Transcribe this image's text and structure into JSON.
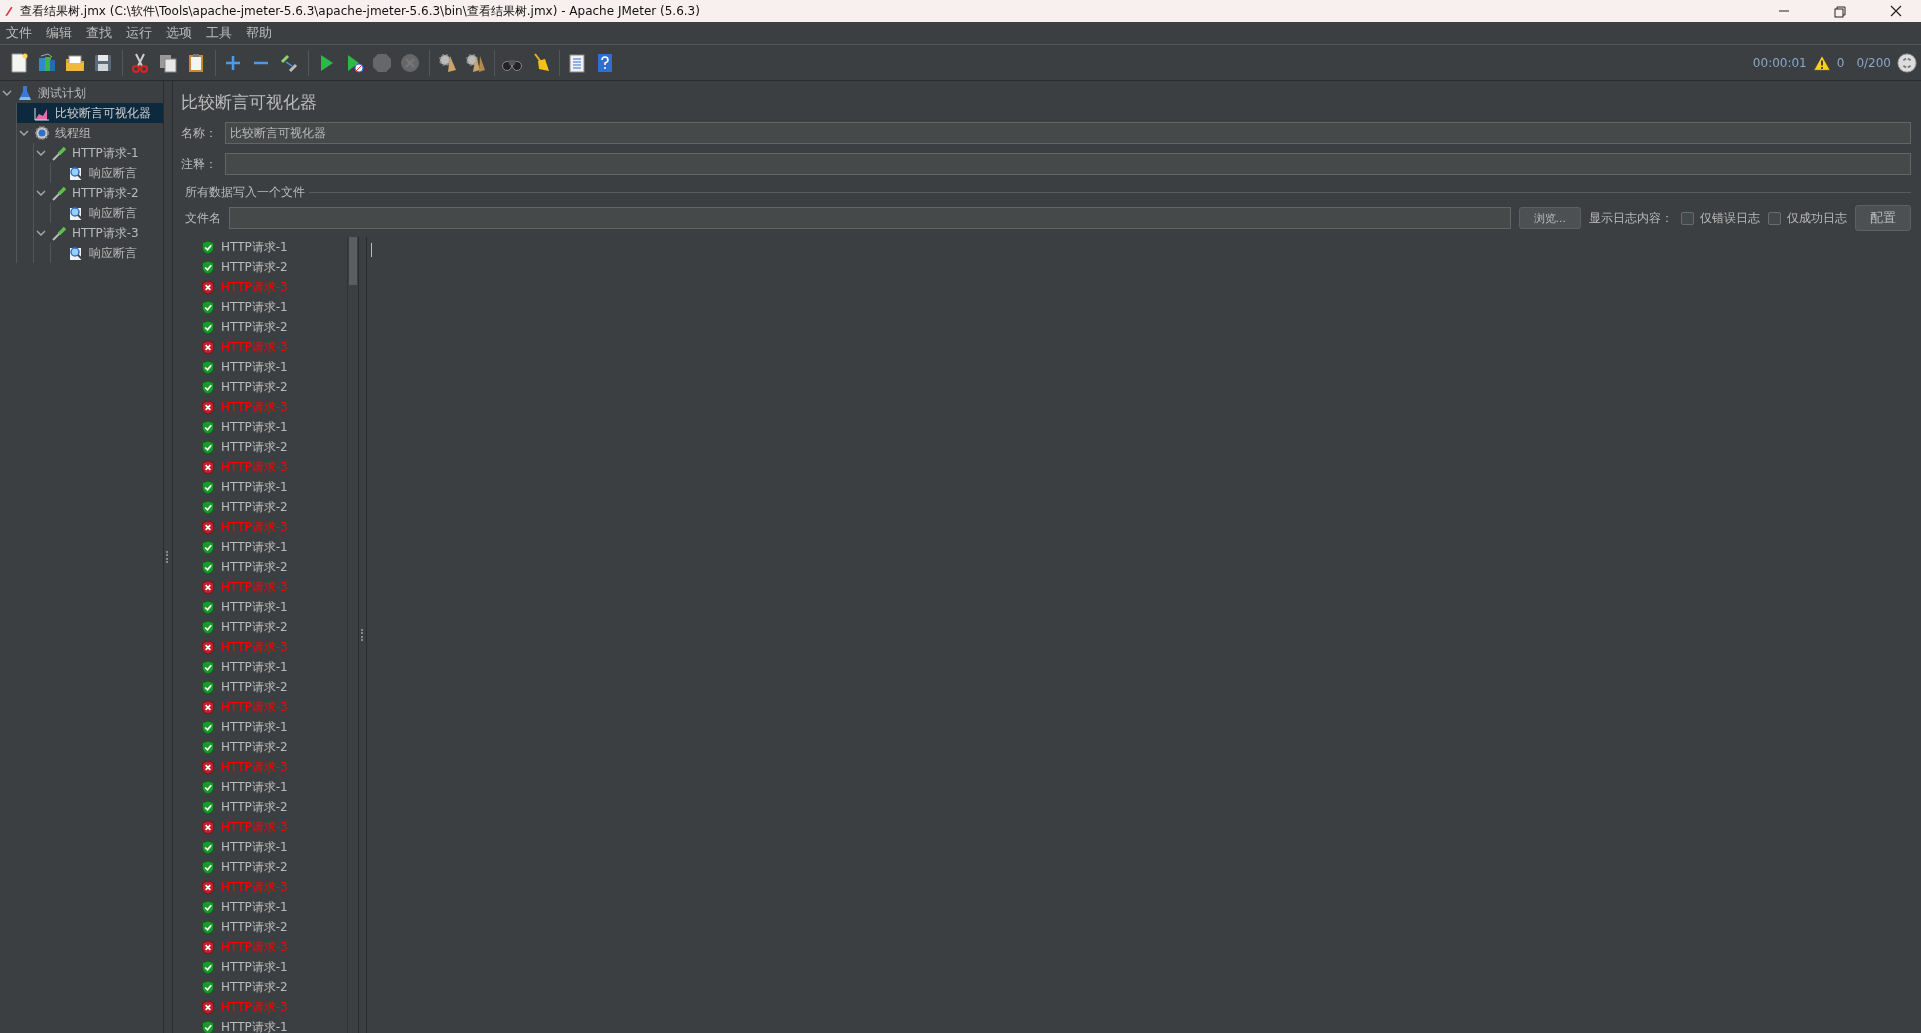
{
  "window": {
    "title": "查看结果树.jmx (C:\\软件\\Tools\\apache-jmeter-5.6.3\\apache-jmeter-5.6.3\\bin\\查看结果树.jmx) - Apache JMeter (5.6.3)"
  },
  "menu": [
    "文件",
    "编辑",
    "查找",
    "运行",
    "选项",
    "工具",
    "帮助"
  ],
  "toolbar": [
    {
      "kind": "new",
      "disabled": false
    },
    {
      "kind": "templates",
      "disabled": false
    },
    {
      "kind": "open",
      "disabled": false
    },
    {
      "kind": "save",
      "disabled": false
    },
    {
      "kind": "sep"
    },
    {
      "kind": "cut",
      "disabled": false
    },
    {
      "kind": "copy",
      "disabled": false
    },
    {
      "kind": "paste",
      "disabled": false
    },
    {
      "kind": "sep"
    },
    {
      "kind": "expand",
      "disabled": false
    },
    {
      "kind": "collapse",
      "disabled": false
    },
    {
      "kind": "toggle",
      "disabled": false
    },
    {
      "kind": "sep"
    },
    {
      "kind": "start",
      "disabled": false
    },
    {
      "kind": "start_nopause",
      "disabled": false
    },
    {
      "kind": "stop",
      "disabled": true
    },
    {
      "kind": "shutdown",
      "disabled": true
    },
    {
      "kind": "sep"
    },
    {
      "kind": "clear",
      "disabled": false
    },
    {
      "kind": "clear_all",
      "disabled": false
    },
    {
      "kind": "sep"
    },
    {
      "kind": "search",
      "disabled": false
    },
    {
      "kind": "reset",
      "disabled": false
    },
    {
      "kind": "sep"
    },
    {
      "kind": "functions",
      "disabled": false
    },
    {
      "kind": "help",
      "disabled": false
    }
  ],
  "status": {
    "elapsed": "00:00:01",
    "warnings": "0",
    "threads": "0/200"
  },
  "tree": [
    {
      "label": "测试计划",
      "kind": "plan",
      "selected": false,
      "expanded": true,
      "children": [
        {
          "label": "比较断言可视化器",
          "kind": "visualizer",
          "selected": true
        },
        {
          "label": "线程组",
          "kind": "threads",
          "selected": false,
          "expanded": true,
          "children": [
            {
              "label": "HTTP请求-1",
              "kind": "sampler",
              "selected": false,
              "expanded": true,
              "children": [
                {
                  "label": "响应断言",
                  "kind": "assertion",
                  "selected": false
                }
              ]
            },
            {
              "label": "HTTP请求-2",
              "kind": "sampler",
              "selected": false,
              "expanded": true,
              "children": [
                {
                  "label": "响应断言",
                  "kind": "assertion",
                  "selected": false
                }
              ]
            },
            {
              "label": "HTTP请求-3",
              "kind": "sampler",
              "selected": false,
              "expanded": true,
              "children": [
                {
                  "label": "响应断言",
                  "kind": "assertion",
                  "selected": false
                }
              ]
            }
          ]
        }
      ]
    }
  ],
  "panel": {
    "title": "比较断言可视化器",
    "name_label": "名称：",
    "name_value": "比较断言可视化器",
    "comment_label": "注释：",
    "file_group": "所有数据写入一个文件",
    "filename_label": "文件名",
    "browse_button": "浏览...",
    "log_label": "显示日志内容：",
    "checkboxes": [
      {
        "label": "仅错误日志",
        "checked": false
      },
      {
        "label": "仅成功日志",
        "checked": false
      }
    ],
    "config_button": "配置"
  },
  "results": [
    {
      "label": "HTTP请求-1",
      "passed": true
    },
    {
      "label": "HTTP请求-2",
      "passed": true
    },
    {
      "label": "HTTP请求-3",
      "passed": false
    },
    {
      "label": "HTTP请求-1",
      "passed": true
    },
    {
      "label": "HTTP请求-2",
      "passed": true
    },
    {
      "label": "HTTP请求-3",
      "passed": false
    },
    {
      "label": "HTTP请求-1",
      "passed": true
    },
    {
      "label": "HTTP请求-2",
      "passed": true
    },
    {
      "label": "HTTP请求-3",
      "passed": false
    },
    {
      "label": "HTTP请求-1",
      "passed": true
    },
    {
      "label": "HTTP请求-2",
      "passed": true
    },
    {
      "label": "HTTP请求-3",
      "passed": false
    },
    {
      "label": "HTTP请求-1",
      "passed": true
    },
    {
      "label": "HTTP请求-2",
      "passed": true
    },
    {
      "label": "HTTP请求-3",
      "passed": false
    },
    {
      "label": "HTTP请求-1",
      "passed": true
    },
    {
      "label": "HTTP请求-2",
      "passed": true
    },
    {
      "label": "HTTP请求-3",
      "passed": false
    },
    {
      "label": "HTTP请求-1",
      "passed": true
    },
    {
      "label": "HTTP请求-2",
      "passed": true
    },
    {
      "label": "HTTP请求-3",
      "passed": false
    },
    {
      "label": "HTTP请求-1",
      "passed": true
    },
    {
      "label": "HTTP请求-2",
      "passed": true
    },
    {
      "label": "HTTP请求-3",
      "passed": false
    },
    {
      "label": "HTTP请求-1",
      "passed": true
    },
    {
      "label": "HTTP请求-2",
      "passed": true
    },
    {
      "label": "HTTP请求-3",
      "passed": false
    },
    {
      "label": "HTTP请求-1",
      "passed": true
    },
    {
      "label": "HTTP请求-2",
      "passed": true
    },
    {
      "label": "HTTP请求-3",
      "passed": false
    },
    {
      "label": "HTTP请求-1",
      "passed": true
    },
    {
      "label": "HTTP请求-2",
      "passed": true
    },
    {
      "label": "HTTP请求-3",
      "passed": false
    },
    {
      "label": "HTTP请求-1",
      "passed": true
    },
    {
      "label": "HTTP请求-2",
      "passed": true
    },
    {
      "label": "HTTP请求-3",
      "passed": false
    },
    {
      "label": "HTTP请求-1",
      "passed": true
    },
    {
      "label": "HTTP请求-2",
      "passed": true
    },
    {
      "label": "HTTP请求-3",
      "passed": false
    },
    {
      "label": "HTTP请求-1",
      "passed": true
    }
  ]
}
